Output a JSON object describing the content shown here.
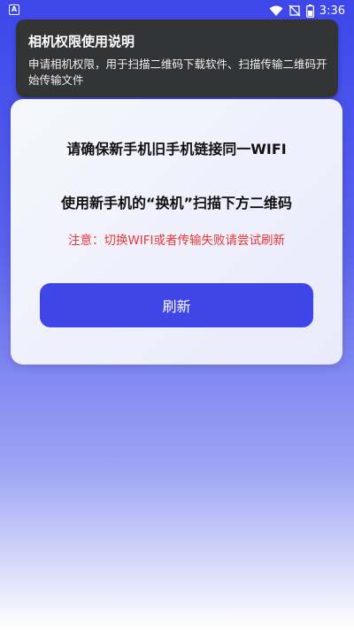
{
  "status_bar": {
    "app_icon_letter": "A",
    "time": "3:36",
    "icons": [
      "wifi-icon",
      "signal-off-icon",
      "battery-icon"
    ]
  },
  "permission_banner": {
    "title": "相机权限使用说明",
    "body": "申请相机权限，用于扫描二维码下载软件、扫描传输二维码开始传输文件"
  },
  "card": {
    "line1": "请确保新手机旧手机链接同一WIFI",
    "line2": "使用新手机的“换机”扫描下方二维码",
    "notice": "注意：切换WIFI或者传输失败请尝试刷新",
    "refresh_label": "刷新"
  },
  "colors": {
    "accent": "#3e46e8",
    "notice": "#e53935",
    "banner_bg": "#333436"
  }
}
